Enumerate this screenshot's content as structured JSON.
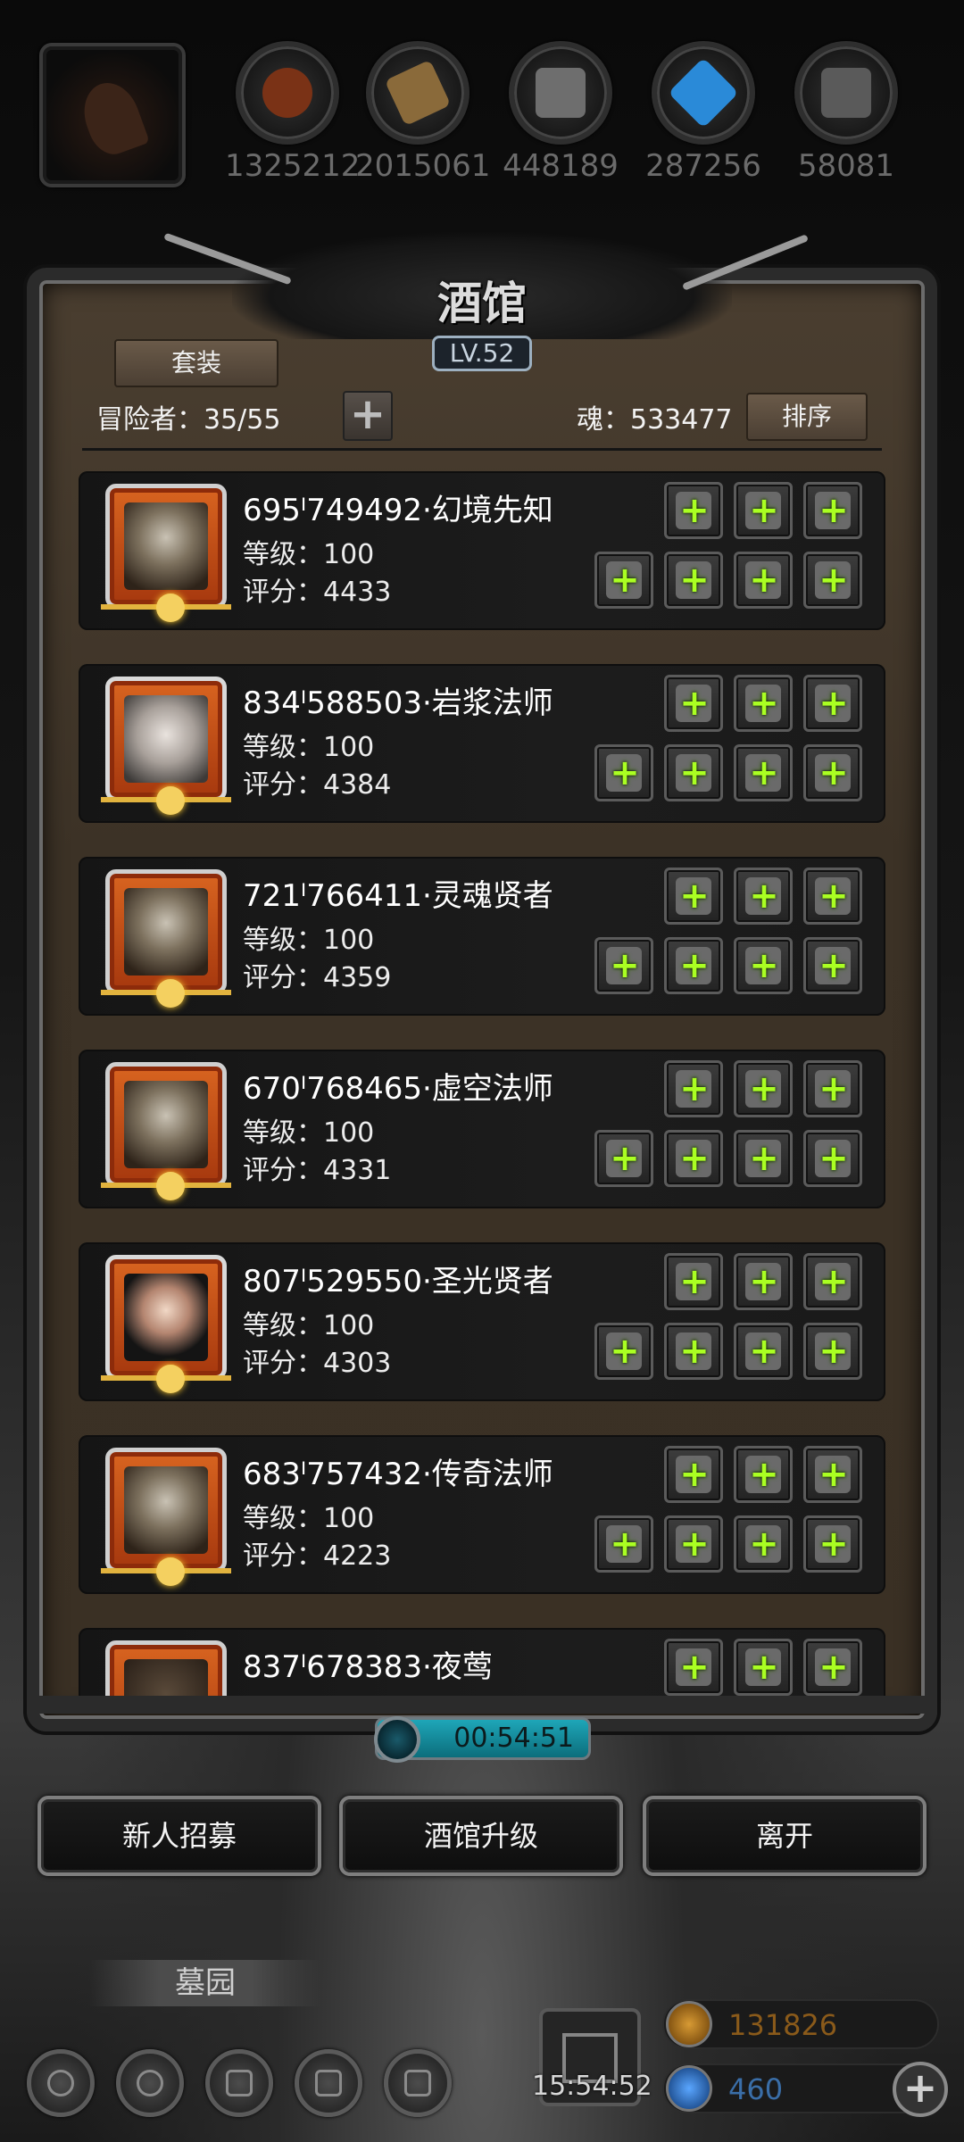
{
  "resources": {
    "items": [
      {
        "value": "1325212",
        "icon": "meat-icon",
        "color": "#8a3a1a"
      },
      {
        "value": "2015061",
        "icon": "wood-icon",
        "color": "#8a6a3a"
      },
      {
        "value": "448189",
        "icon": "iron-ingot-icon",
        "color": "#7a7a7a"
      },
      {
        "value": "287256",
        "icon": "crystal-icon",
        "color": "#2a8ad8"
      },
      {
        "value": "58081",
        "icon": "steel-ingot-icon",
        "color": "#6a6a6a"
      }
    ]
  },
  "tavern": {
    "title": "酒馆",
    "level": "LV.52",
    "set_label": "套装",
    "adventurers_label": "冒险者：35/55",
    "add_label": "+",
    "soul_label": "魂：533477",
    "sort_label": "排序"
  },
  "adventurers": [
    {
      "name": "695ᴵ749492·幻境先知",
      "level": "等级：100",
      "score": "评分：4433",
      "portrait": "old-sage-portrait"
    },
    {
      "name": "834ᴵ588503·岩浆法师",
      "level": "等级：100",
      "score": "评分：4384",
      "portrait": "elf-mage-portrait"
    },
    {
      "name": "721ᴵ766411·灵魂贤者",
      "level": "等级：100",
      "score": "评分：4359",
      "portrait": "old-sage-portrait"
    },
    {
      "name": "670ᴵ768465·虚空法师",
      "level": "等级：100",
      "score": "评分：4331",
      "portrait": "old-sage-portrait"
    },
    {
      "name": "807ᴵ529550·圣光贤者",
      "level": "等级：100",
      "score": "评分：4303",
      "portrait": "nun-portrait"
    },
    {
      "name": "683ᴵ757432·传奇法师",
      "level": "等级：100",
      "score": "评分：4223",
      "portrait": "old-sage-portrait"
    },
    {
      "name": "837ᴵ678383·夜莺",
      "level": "",
      "score": "",
      "portrait": "rogue-portrait"
    }
  ],
  "timer": "00:54:51",
  "actions": {
    "recruit": "新人招募",
    "upgrade": "酒馆升级",
    "leave": "离开"
  },
  "footer": {
    "location": "墓园",
    "gift_timer": "15:54:52",
    "gold": "131826",
    "gems": "460",
    "gem_add": "+"
  },
  "colors": {
    "plus_green": "#aaff22",
    "portrait_frame": "#d86420",
    "timer_accent": "#1ea6b8"
  }
}
